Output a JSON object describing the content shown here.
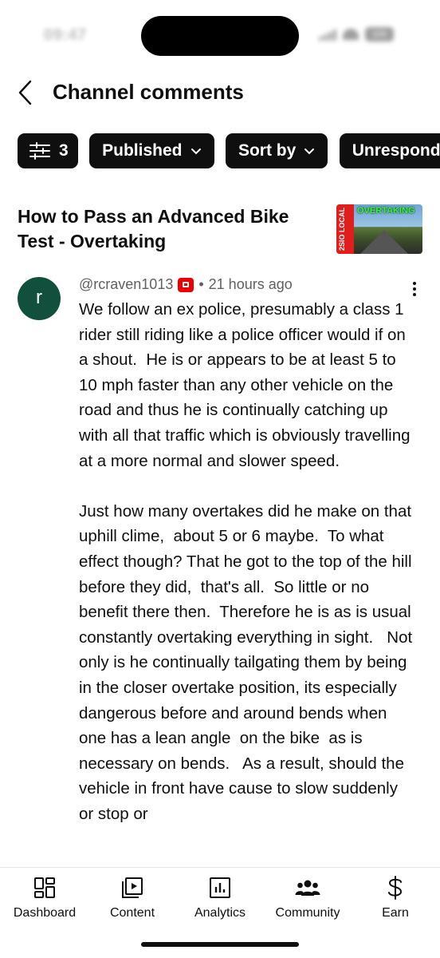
{
  "status_bar": {
    "time": "09:47",
    "battery": "100"
  },
  "header": {
    "title": "Channel comments"
  },
  "filters": [
    {
      "label": "3",
      "icon": "filter-sliders-icon"
    },
    {
      "label": "Published"
    },
    {
      "label": "Sort by"
    },
    {
      "label": "Unresponded"
    }
  ],
  "video": {
    "title": "How to Pass an Advanced Bike Test - Overtaking",
    "thumbnail": {
      "side_text": "2SIO LOCAL",
      "label": "OVERTAKING"
    }
  },
  "comment": {
    "avatar_letter": "r",
    "author": "@rcraven1013",
    "separator": "•",
    "time": "21 hours ago",
    "text": "We follow an ex police, presumably a class 1 rider still riding like a police officer would if on a shout.  He is or appears to be at least 5 to 10 mph faster than any other vehicle on the road and thus he is continually catching up with all that traffic which is obviously travelling at a more normal and slower speed.\n\nJust how many overtakes did he make on that uphill clime,  about 5 or 6 maybe.  To what effect though? That he got to the top of the hill before they did,  that's all.  So little or no benefit there then.  Therefore he is as is usual constantly overtaking everything in sight.   Not only is he continually tailgating them by being in the closer overtake position, its especially dangerous before and around bends when one has a lean angle  on the bike  as is  necessary on bends.   As a result, should the vehicle in front have cause to slow suddenly or stop or"
  },
  "nav": [
    {
      "label": "Dashboard",
      "icon": "dashboard-icon"
    },
    {
      "label": "Content",
      "icon": "content-icon"
    },
    {
      "label": "Analytics",
      "icon": "analytics-icon"
    },
    {
      "label": "Community",
      "icon": "community-icon"
    },
    {
      "label": "Earn",
      "icon": "earn-dollar-icon"
    }
  ]
}
